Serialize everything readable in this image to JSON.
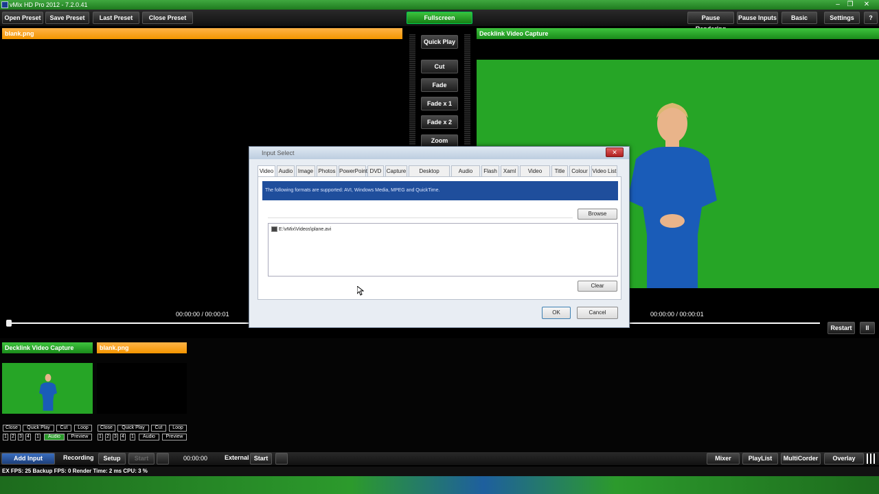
{
  "window": {
    "title": "vMix HD Pro 2012 - 7.2.0.41",
    "min": "‒",
    "max": "❐",
    "close": "✕"
  },
  "toolbar": {
    "open_preset": "Open Preset",
    "save_preset": "Save Preset",
    "last_preset": "Last Preset",
    "close_preset": "Close Preset",
    "fullscreen": "Fullscreen",
    "pause_rendering": "Pause Rendering",
    "pause_inputs": "Pause Inputs",
    "basic": "Basic",
    "settings": "Settings",
    "help": "?"
  },
  "preview": {
    "title": "blank.png",
    "timecode": "00:00:00 / 00:00:01"
  },
  "output": {
    "title": "Decklink Video Capture",
    "timecode": "00:00:00 / 00:00:01",
    "restart": "Restart",
    "pause": "II"
  },
  "transitions": {
    "quick_play": "Quick Play",
    "cut": "Cut",
    "fade": "Fade",
    "fade_x1": "Fade x 1",
    "fade_x2": "Fade x 2",
    "zoom": "Zoom"
  },
  "dialog": {
    "title": "Input Select",
    "tabs": [
      "Video",
      "Audio",
      "Image",
      "Photos",
      "PowerPoint",
      "DVD",
      "Capture",
      "Desktop Capture",
      "Audio Input",
      "Flash",
      "Xaml",
      "Video Delay",
      "Title",
      "Colour",
      "Video List"
    ],
    "info": "The following formats are supported: AVI, Windows Media, MPEG and QuickTime.",
    "browse": "Browse",
    "files": [
      "E:\\vMix\\Videos\\plane.avi"
    ],
    "clear": "Clear",
    "ok": "OK",
    "cancel": "Cancel"
  },
  "inputs": [
    {
      "title": "Decklink Video Capture",
      "color": "#2a9a2a",
      "buttons": [
        "Close",
        "Quick Play",
        "Cut",
        "Loop"
      ],
      "numbers": [
        "1",
        "2",
        "3",
        "4",
        "1"
      ],
      "audio": "Audio",
      "preview": "Preview"
    },
    {
      "title": "blank.png",
      "color": "#f39500",
      "buttons": [
        "Close",
        "Quick Play",
        "Cut",
        "Loop"
      ],
      "numbers": [
        "1",
        "2",
        "3",
        "4",
        "1"
      ],
      "audio": "Audio",
      "preview": "Preview"
    }
  ],
  "bottombar": {
    "add_input": "Add Input",
    "recording": "Recording",
    "setup": "Setup",
    "start": "Start",
    "time": "00:00:00",
    "external": "External",
    "start2": "Start",
    "mixer": "Mixer",
    "playlist": "PlayList",
    "multicorder": "MultiCorder",
    "overlay": "Overlay"
  },
  "status": {
    "text": "EX FPS: 25  Backup FPS: 0  Render Time: 2 ms  CPU: 3 %"
  }
}
